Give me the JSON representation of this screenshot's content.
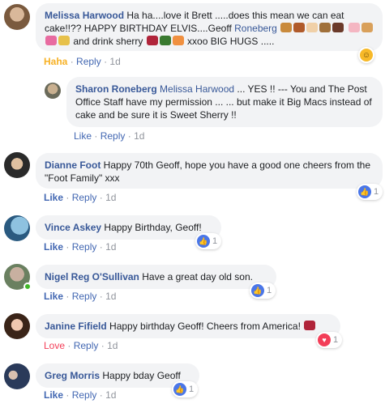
{
  "colors": {
    "link": "#385898",
    "action": "#4267b2",
    "bubble": "#f2f3f5",
    "meta": "#90949c",
    "haha": "#f7b125",
    "love": "#f33e58",
    "like": "#4a76e8"
  },
  "comments": [
    {
      "name": "Melissa Harwood",
      "text_a": "Ha ha....love it Brett .....does this mean we can eat cake!!?? HAPPY BIRTHDAY ELVIS....Geoff ",
      "mention": "Roneberg",
      "text_b": " and drink sherry ",
      "text_c": " xxoo BIG HUGS .....",
      "reaction_label": "Haha",
      "reply": "Reply",
      "time": "1d",
      "reaction_icon": "haha-icon"
    },
    {
      "name": "Sharon Roneberg",
      "mention": "Melissa Harwood",
      "text": " ... YES !! --- You and The Post Office Staff have my permission ... ... but make it Big Macs instead of cake and be sure it is Sweet Sherry !!",
      "like": "Like",
      "reply": "Reply",
      "time": "1d"
    },
    {
      "name": "Dianne Foot",
      "text": " Happy 70th Geoff, hope you have a good one cheers from the \"Foot Family\" xxx",
      "like": "Like",
      "reply": "Reply",
      "time": "1d",
      "count": "1"
    },
    {
      "name": "Vince Askey",
      "text": " Happy Birthday, Geoff!",
      "like": "Like",
      "reply": "Reply",
      "time": "1d",
      "count": "1"
    },
    {
      "name": "Nigel Reg O'Sullivan",
      "text": " Have a great day old son.",
      "like": "Like",
      "reply": "Reply",
      "time": "1d",
      "count": "1"
    },
    {
      "name": "Janine Fifield",
      "text": " Happy birthday Geoff! Cheers from America! ",
      "reaction_label": "Love",
      "reply": "Reply",
      "time": "1d",
      "count": "1"
    },
    {
      "name": "Greg Morris",
      "text": " Happy bday Geoff",
      "like": "Like",
      "reply": "Reply",
      "time": "1d",
      "count": "1"
    }
  ],
  "separator": "·"
}
